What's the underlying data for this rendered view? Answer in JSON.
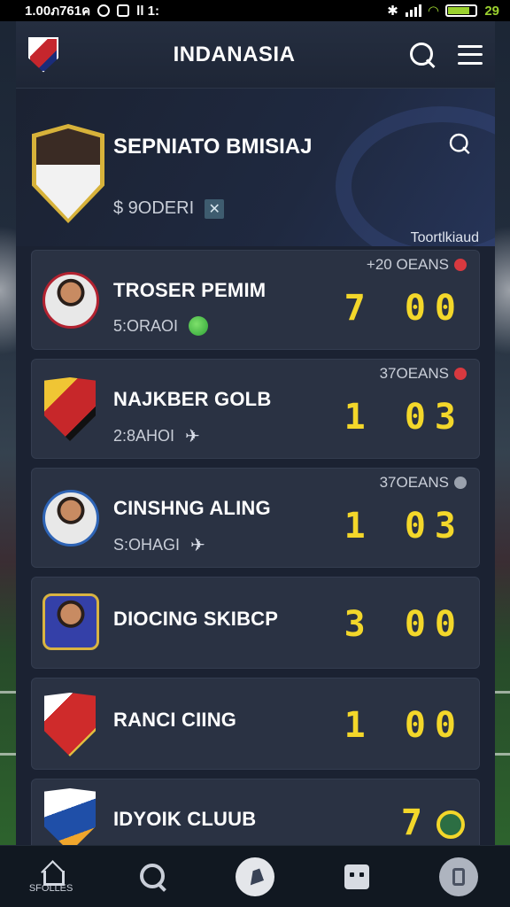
{
  "status_bar": {
    "time": "1.00ภ761ค",
    "signal_text": "ll 1:",
    "battery_text": "29"
  },
  "header": {
    "title": "INDANASIA"
  },
  "featured": {
    "name": "SEPNIATO BMISIAJ",
    "subtitle": "$ 9ODERI",
    "side_label": "Toortlkiaud"
  },
  "rows": [
    {
      "name": "TROSER PEMIM",
      "sub": "5:ORAOI",
      "meta": "+20 OEANS",
      "score": "7 00"
    },
    {
      "name": "NAJKBER GOLB",
      "sub": "2:8AHOI",
      "meta": "37OEANS",
      "score": "1 03"
    },
    {
      "name": "CINSHNG ALING",
      "sub": "S:OHAGI",
      "meta": "37OEANS",
      "score": "1 03"
    },
    {
      "name": "DIOCING SKIBCP",
      "sub": "",
      "meta": "",
      "score": "3 00"
    },
    {
      "name": "RANCI CIING",
      "sub": "",
      "meta": "",
      "score": "1 00"
    },
    {
      "name": "IDYOIK CLUUB",
      "sub": "",
      "meta": "",
      "score": "7"
    }
  ],
  "bottom_nav": {
    "home_label": "SFOLLES"
  },
  "colors": {
    "score": "#f3d72a",
    "accent_red": "#d8393f",
    "panel": "#2a3243"
  }
}
